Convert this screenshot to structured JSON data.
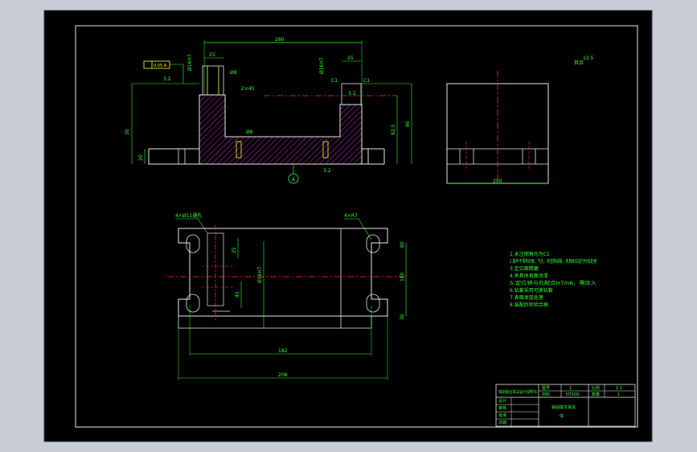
{
  "colors": {
    "window_bg": "#c7ccd6",
    "canvas": "#000000",
    "frame": "#ffffff",
    "outline": "#e8e8e8",
    "dimension": "#33ff33",
    "centerline": "#ff3333",
    "hatch": "#cc33cc",
    "leader": "#ffff33"
  },
  "front_view": {
    "top_width": "280",
    "left_gap": "25",
    "right_gap": "25",
    "height_left": "30",
    "height_right_inner": "92.5",
    "height_right_outer": "80",
    "base_height": "20",
    "slot_label": "2×45",
    "datum_label": "A",
    "tolerance_box": "0.05 A",
    "fit_label": "Ø16H7",
    "fit_label_right": "Ø16H7",
    "chamfer_left": "C1",
    "chamfer_right": "C1",
    "roughness_top": "3.2",
    "roughness_bottom": "3.2",
    "roughness_left": "3.2",
    "counterbore_label": "Ø8",
    "counterbore_label_2": "Ø8"
  },
  "side_view": {
    "width_label": "200",
    "roughness_note": "其余",
    "roughness_value": "12.5"
  },
  "top_view": {
    "callout_left": "4×Ø11通孔",
    "callout_right": "4×R7",
    "inner_width": "182",
    "outer_width": "208",
    "height_label": "160",
    "vertical_dim_1": "80",
    "vertical_dim_2": "30",
    "vertical_dim_3": "25",
    "vertical_dim_4": "45",
    "pitch_label": "Ø16H7"
  },
  "tech_notes": [
    "1.未注倒角均为C1",
    "2.铸件不得有砂眼、气孔、夹渣等缺陷，夹具体应进行时效处理",
    "3.定位面精磨",
    "4.夹具体表面涂漆",
    "5.定位销与孔配合H7/n6，需压入",
    "6.钻套采用可换钻套",
    "7.表面发蓝处理",
    "8.装配后检验合格"
  ],
  "title_block": {
    "company": "铣削组合夹具设计说明书",
    "row1_label": "图号",
    "row1_value": "1",
    "row1_scale_label": "比例",
    "row1_scale_value": "1:1",
    "row2_label": "材料",
    "row2_value": "HT200",
    "row2_count_label": "数量",
    "row2_count_value": "1",
    "left_labels": [
      "设计",
      "审核",
      "批准",
      "日期"
    ],
    "part_name": "铣削拨叉夹具",
    "part_sub": "体"
  }
}
